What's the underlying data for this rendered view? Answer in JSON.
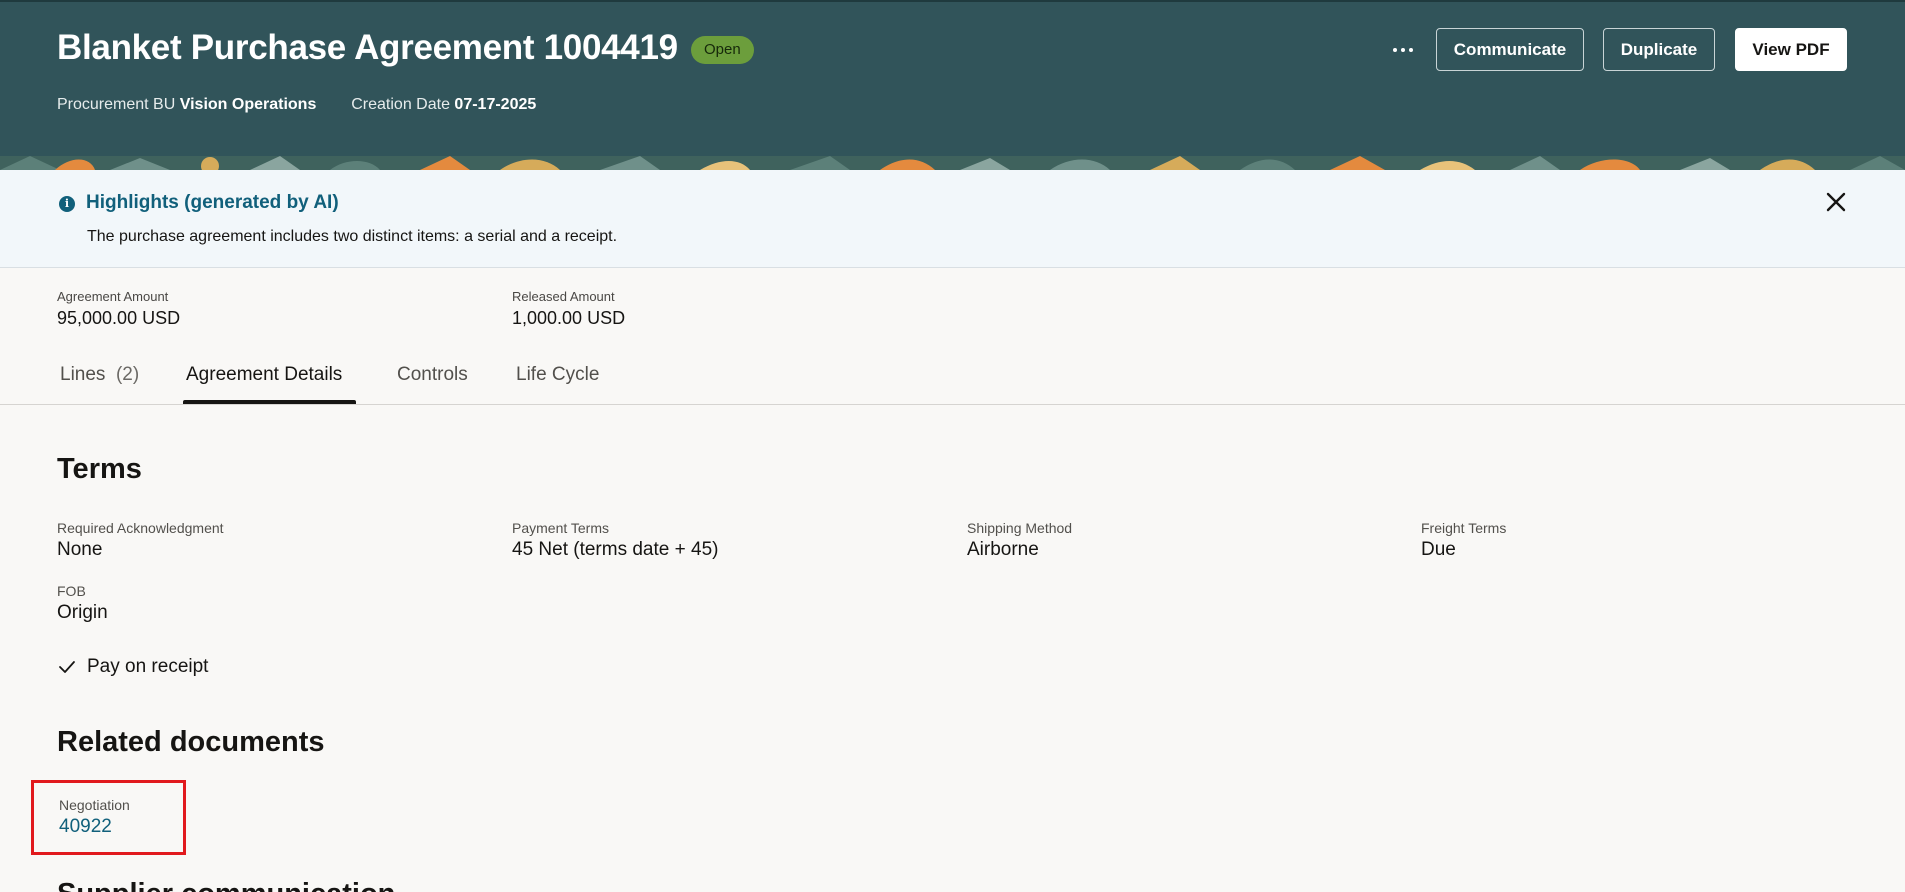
{
  "header": {
    "title": "Blanket Purchase Agreement 1004419",
    "status": "Open",
    "procurement_bu_label": "Procurement BU",
    "procurement_bu_value": "Vision Operations",
    "creation_date_label": "Creation Date",
    "creation_date_value": "07-17-2025",
    "buttons": {
      "communicate": "Communicate",
      "duplicate": "Duplicate",
      "view_pdf": "View PDF"
    }
  },
  "highlights": {
    "title": "Highlights (generated by AI)",
    "text": "The purchase agreement includes two distinct items: a serial and a receipt."
  },
  "amounts": {
    "agreement_label": "Agreement Amount",
    "agreement_value": "95,000.00 USD",
    "released_label": "Released Amount",
    "released_value": "1,000.00 USD"
  },
  "tabs": [
    {
      "label": "Lines",
      "count": "(2)"
    },
    {
      "label": "Agreement Details"
    },
    {
      "label": "Controls"
    },
    {
      "label": "Life Cycle"
    }
  ],
  "terms": {
    "title": "Terms",
    "fields": [
      {
        "label": "Required Acknowledgment",
        "value": "None"
      },
      {
        "label": "Payment Terms",
        "value": "45 Net (terms date + 45)"
      },
      {
        "label": "Shipping Method",
        "value": "Airborne"
      },
      {
        "label": "Freight Terms",
        "value": "Due"
      },
      {
        "label": "FOB",
        "value": "Origin"
      }
    ],
    "pay_on_receipt": "Pay on receipt"
  },
  "related_documents": {
    "title": "Related documents",
    "negotiation_label": "Negotiation",
    "negotiation_value": "40922"
  },
  "next_section_title": "Supplier communication",
  "colors": {
    "header_bg": "#31545a",
    "status_badge": "#6c9e3c",
    "link": "#11607b",
    "highlight_box": "#e1191d"
  }
}
